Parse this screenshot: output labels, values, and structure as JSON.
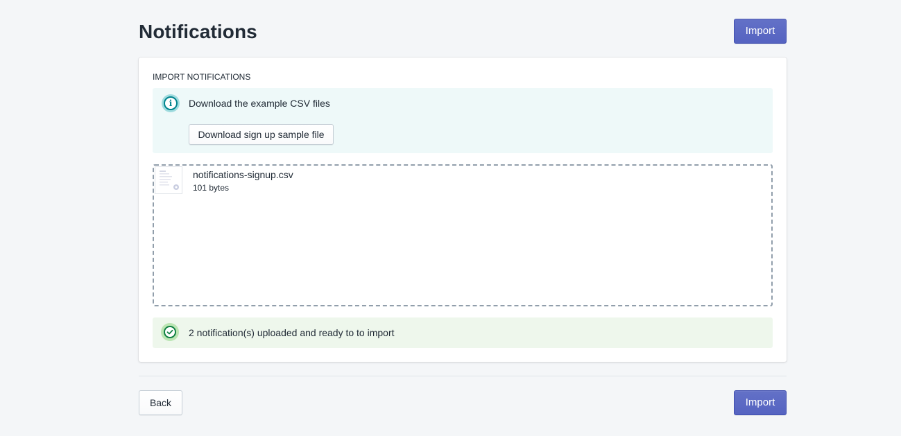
{
  "page": {
    "title": "Notifications",
    "import_label": "Import"
  },
  "card": {
    "heading": "IMPORT NOTIFICATIONS",
    "info_banner": {
      "icon": "info-icon",
      "text": "Download the example CSV files",
      "button_label": "Download sign up sample file"
    },
    "dropzone": {
      "file": {
        "name": "notifications-signup.csv",
        "size": "101 bytes",
        "icon": "file-thumbnail-icon"
      }
    },
    "success_banner": {
      "icon": "checkmark-circle-icon",
      "text": "2 notification(s) uploaded and ready to to import"
    }
  },
  "footer": {
    "back_label": "Back",
    "import_label": "Import"
  },
  "colors": {
    "primary": "#5c6ac4",
    "info_bg": "#eef9f9",
    "info_icon": "#00848e",
    "success_bg": "#eef7ec",
    "success_icon": "#108043",
    "page_bg": "#f4f6f8"
  }
}
